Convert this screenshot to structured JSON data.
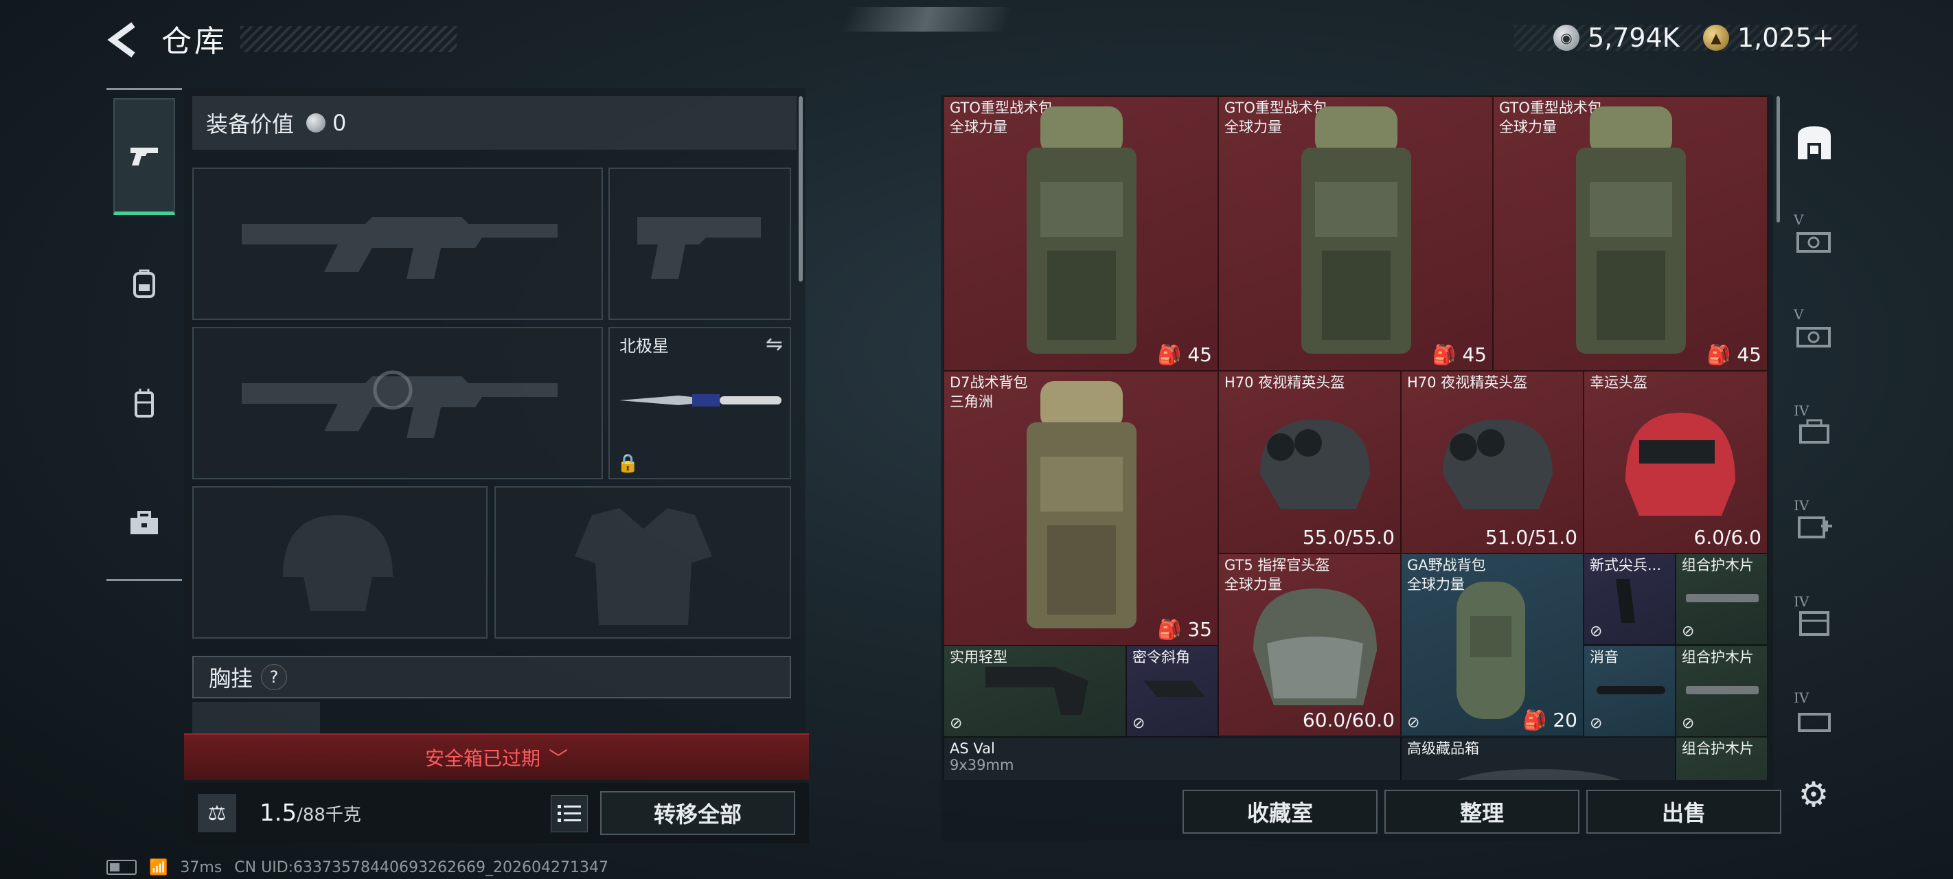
{
  "header": {
    "back_icon": "back-arrow-icon",
    "title": "仓库",
    "currency": [
      {
        "icon": "silver-coin-icon",
        "value": "5,794K"
      },
      {
        "icon": "gold-coin-icon",
        "value": "1,025+"
      }
    ]
  },
  "left_rail": {
    "tabs": [
      {
        "icon": "pistol-icon",
        "active": true
      },
      {
        "icon": "backpack-icon",
        "active": false
      },
      {
        "icon": "chest-rig-icon",
        "active": false
      },
      {
        "icon": "toolbox-icon",
        "active": false
      }
    ]
  },
  "equipment": {
    "value_label": "装备价值",
    "value": "0",
    "melee_name": "北极星",
    "chest_rig_label": "胸挂",
    "help": "?",
    "safebox_text": "安全箱已过期",
    "weight_current": "1.5",
    "weight_max": "/88千克",
    "transfer_label": "转移全部"
  },
  "status": {
    "ping": "37ms",
    "uid": "CN UID:6337357844069326266​9_202604271347"
  },
  "inventory": {
    "items": [
      {
        "id": "c1",
        "name": "GTO重型战术包",
        "sub": "全球力量",
        "value": "45",
        "rarity": "red"
      },
      {
        "id": "c2",
        "name": "GTO重型战术包",
        "sub": "全球力量",
        "value": "45",
        "rarity": "red"
      },
      {
        "id": "c3",
        "name": "GTO重型战术包",
        "sub": "全球力量",
        "value": "45",
        "rarity": "red"
      },
      {
        "id": "c4",
        "name": "D7战术背包",
        "sub": "三角洲",
        "value": "35",
        "rarity": "red"
      },
      {
        "id": "c5",
        "name": "H70 夜视精英头盔",
        "sub": "",
        "value": "55.0/55.0",
        "rarity": "red"
      },
      {
        "id": "c6",
        "name": "H70 夜视精英头盔",
        "sub": "",
        "value": "51.0/51.0",
        "rarity": "red"
      },
      {
        "id": "c7",
        "name": "幸运头盔",
        "sub": "",
        "value": "6.0/6.0",
        "rarity": "red"
      },
      {
        "id": "c8",
        "name": "GT5 指挥官头盔",
        "sub": "全球力量",
        "value": "60.0/60.0",
        "rarity": "red"
      },
      {
        "id": "c9",
        "name": "GA野战背包",
        "sub": "全球力量",
        "value": "20",
        "rarity": "blue"
      },
      {
        "id": "c10",
        "name": "新式尖兵...",
        "sub": "",
        "value": "",
        "rarity": "purple"
      },
      {
        "id": "c11",
        "name": "组合护木片",
        "sub": "",
        "value": "",
        "rarity": "green"
      },
      {
        "id": "c12",
        "name": "实用轻型",
        "sub": "",
        "value": "",
        "rarity": "green"
      },
      {
        "id": "c13",
        "name": "密令斜角",
        "sub": "",
        "value": "",
        "rarity": "purple"
      },
      {
        "id": "c14",
        "name": "消音",
        "sub": "",
        "value": "",
        "rarity": "blue"
      },
      {
        "id": "c15",
        "name": "组合护木片",
        "sub": "",
        "value": "",
        "rarity": "green"
      },
      {
        "id": "c16",
        "name": "AS Val",
        "sub": "9x39mm",
        "value": "",
        "rarity": "dark"
      },
      {
        "id": "c17",
        "name": "高级藏品箱",
        "sub": "",
        "value": "",
        "rarity": "dark"
      },
      {
        "id": "c18",
        "name": "组合护木片",
        "sub": "",
        "value": "",
        "rarity": "green"
      }
    ]
  },
  "right_rail": {
    "tabs": [
      {
        "icon": "vault-icon",
        "label": ""
      },
      {
        "icon": "storage-v-icon",
        "label": "V"
      },
      {
        "icon": "storage-v2-icon",
        "label": "V"
      },
      {
        "icon": "storage-iv-icon",
        "label": "IV"
      },
      {
        "icon": "storage-iv-add-icon",
        "label": "IV"
      },
      {
        "icon": "storage-iv-box-icon",
        "label": "IV"
      },
      {
        "icon": "storage-iv-last-icon",
        "label": "IV"
      }
    ]
  },
  "actions": {
    "collection": "收藏室",
    "sort": "整理",
    "sell": "出售"
  },
  "colors": {
    "accent_green": "#3fd29b",
    "rarity_red": "#6a2a30",
    "rarity_blue": "#2a4656",
    "rarity_green": "#2a3c34",
    "rarity_purple": "#2c2c46",
    "warning_red": "#ff5a5f"
  }
}
